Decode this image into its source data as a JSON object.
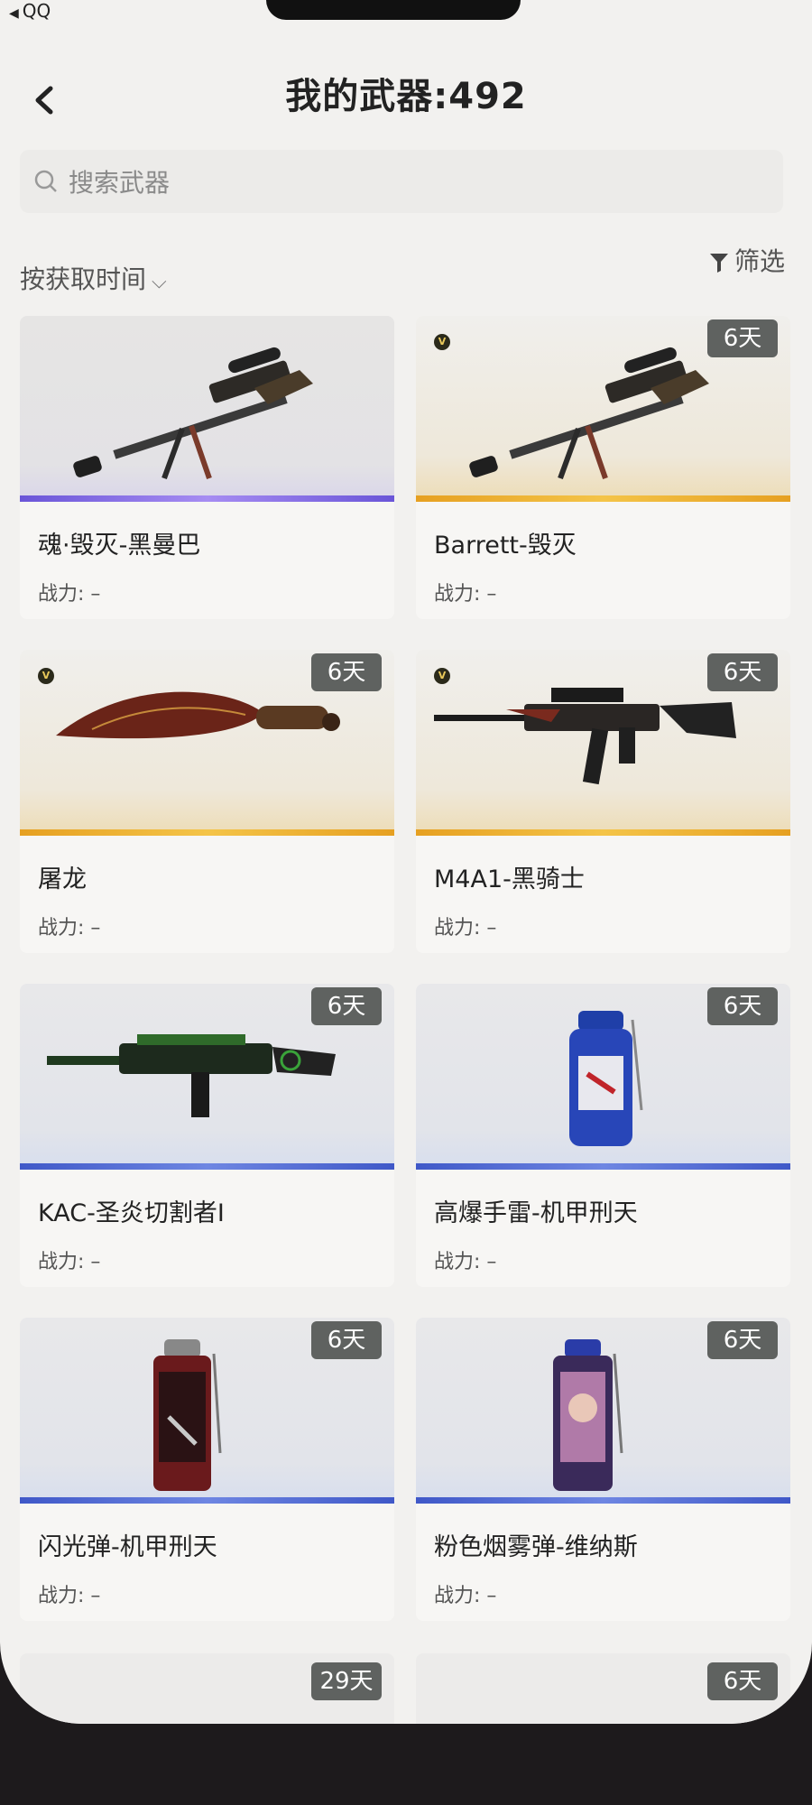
{
  "status_bar": {
    "back_app": "QQ"
  },
  "header": {
    "title": "我的武器:492"
  },
  "search": {
    "placeholder": "搜索武器"
  },
  "controls": {
    "sort_label": "按获取时间",
    "filter_label": "筛选"
  },
  "power_label": "战力: –",
  "weapons": [
    {
      "name": "魂·毁灭-黑曼巴",
      "days": "",
      "vip": false,
      "rarity": "purple",
      "icon": "sniper-rifle-icon"
    },
    {
      "name": "Barrett-毁灭",
      "days": "6天",
      "vip": true,
      "rarity": "gold",
      "icon": "sniper-rifle-icon"
    },
    {
      "name": "屠龙",
      "days": "6天",
      "vip": true,
      "rarity": "gold",
      "icon": "knife-icon"
    },
    {
      "name": "M4A1-黑骑士",
      "days": "6天",
      "vip": true,
      "rarity": "gold",
      "icon": "assault-rifle-icon"
    },
    {
      "name": "KAC-圣炎切割者I",
      "days": "6天",
      "vip": false,
      "rarity": "blue",
      "icon": "machine-gun-icon"
    },
    {
      "name": "高爆手雷-机甲刑天",
      "days": "6天",
      "vip": false,
      "rarity": "blue",
      "icon": "grenade-icon"
    },
    {
      "name": "闪光弹-机甲刑天",
      "days": "6天",
      "vip": false,
      "rarity": "blue",
      "icon": "flashbang-icon"
    },
    {
      "name": "粉色烟雾弹-维纳斯",
      "days": "6天",
      "vip": false,
      "rarity": "blue",
      "icon": "smoke-grenade-icon"
    }
  ],
  "partial_row": [
    {
      "days": "29天"
    },
    {
      "days": "6天"
    }
  ],
  "colors": {
    "badge_bg": "#5f6260",
    "purple": "#6a55d8",
    "gold": "#f4c448",
    "blue": "#3f58c8"
  }
}
